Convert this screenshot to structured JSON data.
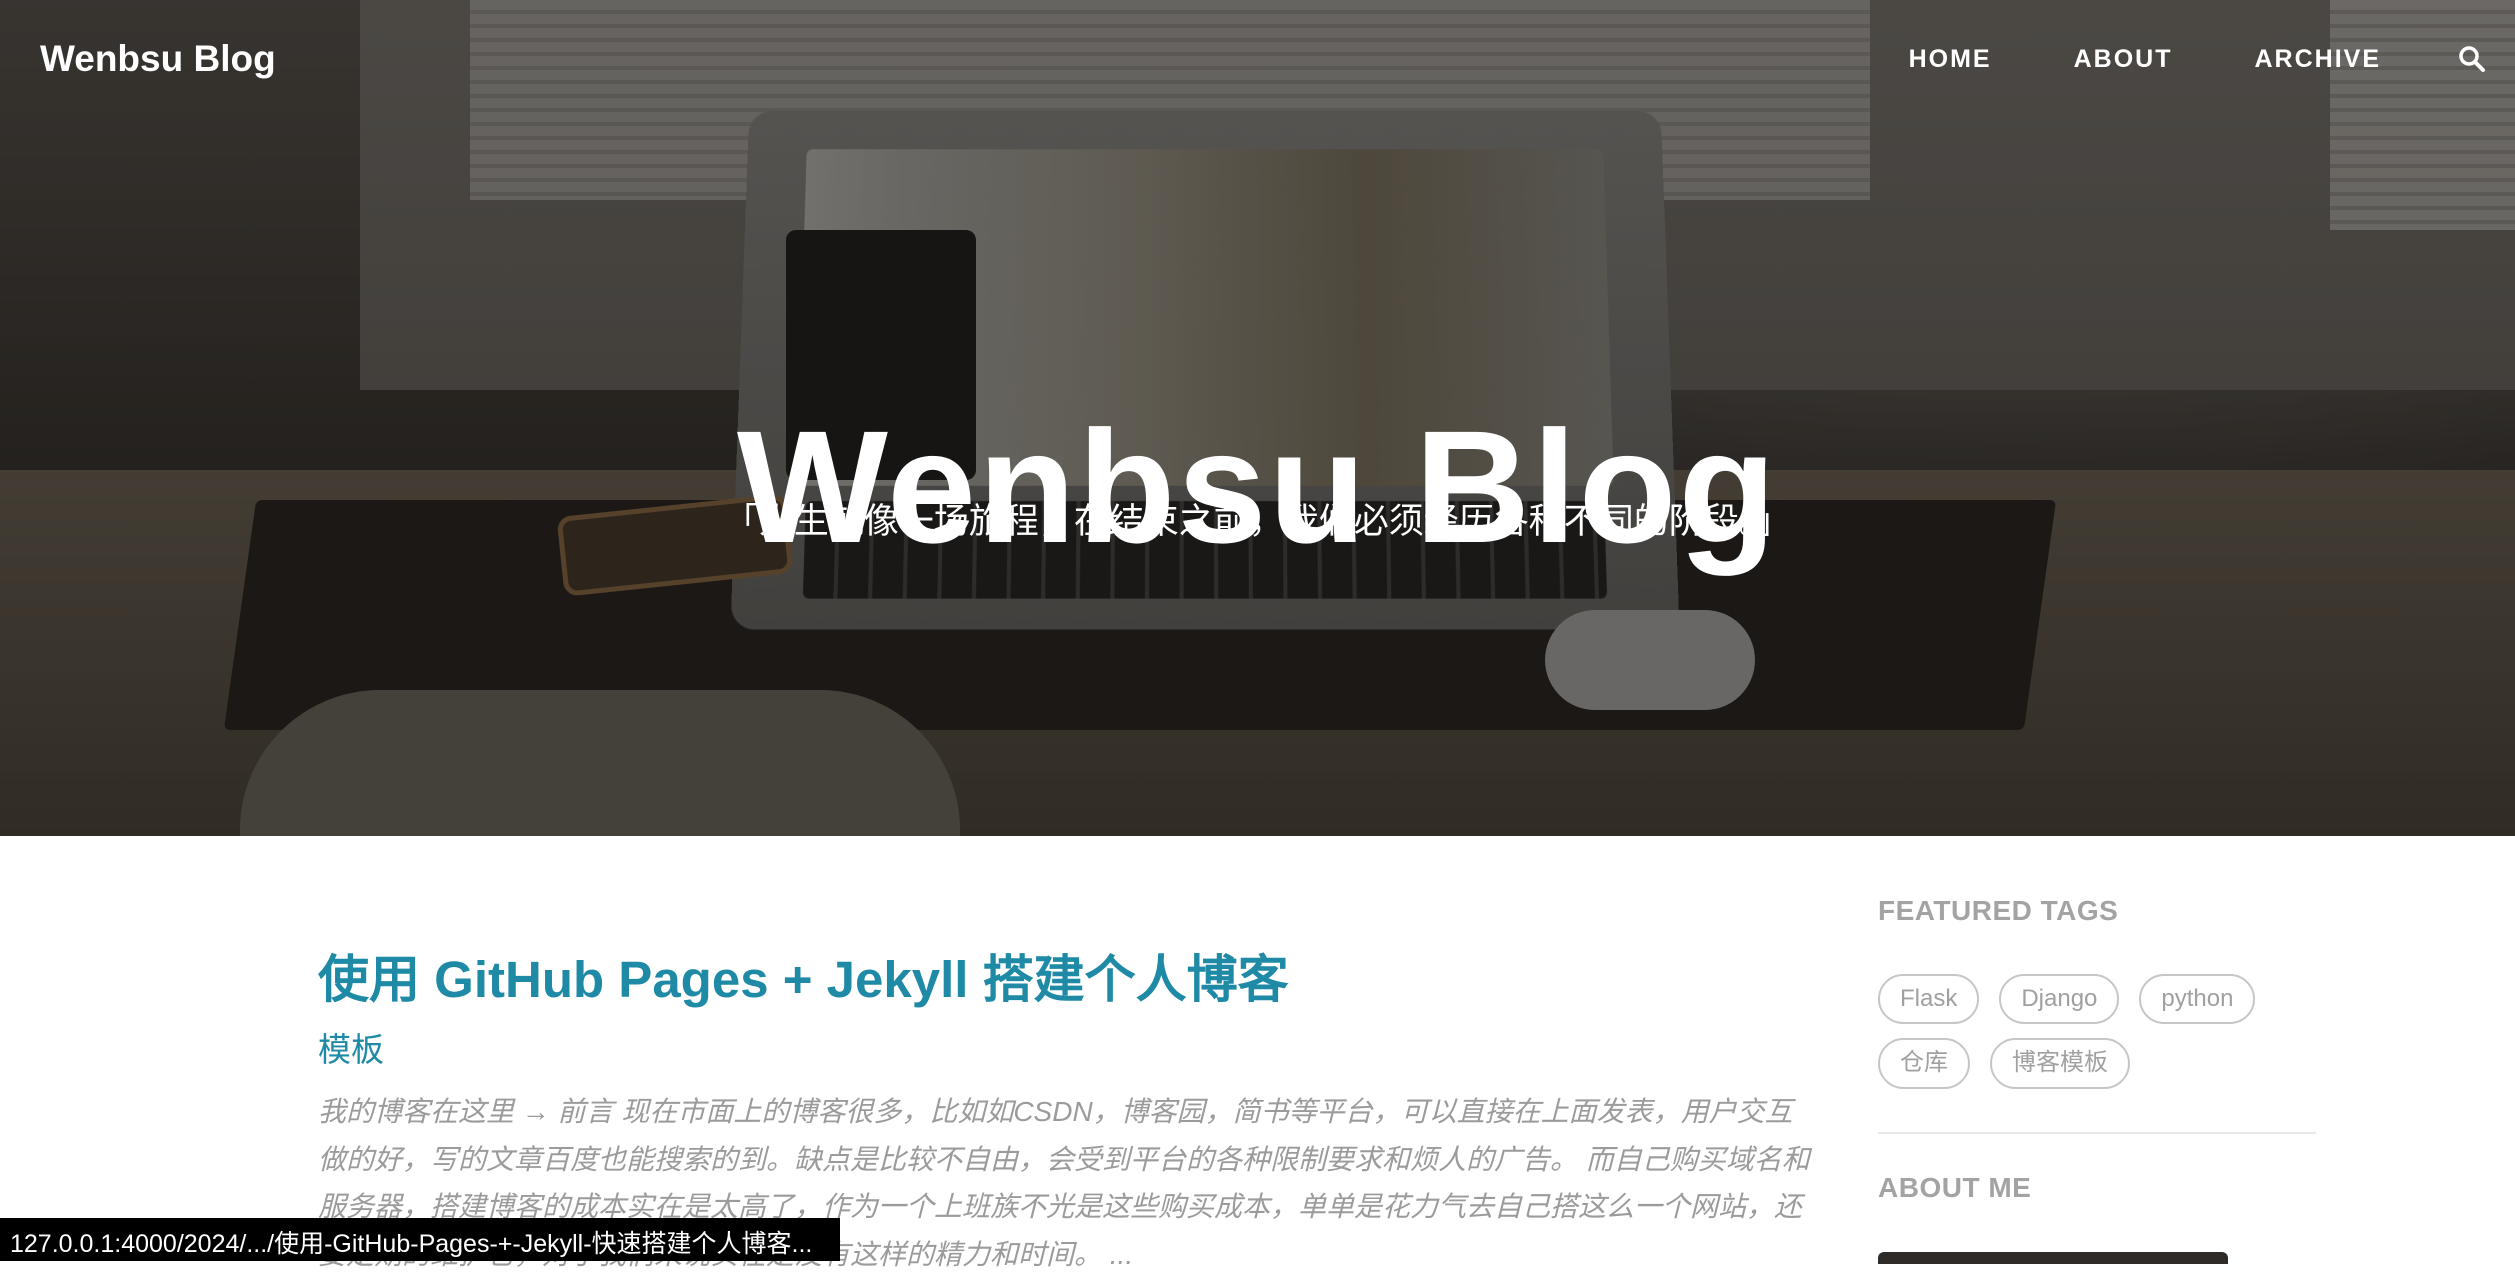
{
  "nav": {
    "brand": "Wenbsu Blog",
    "links": [
      "HOME",
      "ABOUT",
      "ARCHIVE"
    ],
    "search_icon": "search-icon"
  },
  "hero": {
    "title": "Wenbsu Blog",
    "subtitle": "「人生就像一场旅程，在结束之前，我们必须经历各种不同的阶段。」"
  },
  "post": {
    "title": "使用 GitHub Pages + Jekyll 搭建个人博客",
    "subtitle": "模板",
    "excerpt": "我的博客在这里 → 前言 现在市面上的博客很多，比如如CSDN，博客园，简书等平台，可以直接在上面发表，用户交互做的好，写的文章百度也能搜索的到。缺点是比较不自由，会受到平台的各种限制要求和烦人的广告。 而自己购买域名和服务器，搭建博客的成本实在是太高了，作为一个上班族不光是这些购买成本，单单是花力气去自己搭这么一个网站，还要定期的维护它，对于我们来说实在是没有这样的精力和时间。 ..."
  },
  "sidebar": {
    "featured_tags_heading": "FEATURED TAGS",
    "tags": [
      "Flask",
      "Django",
      "python",
      "仓库",
      "博客模板"
    ],
    "about_heading": "ABOUT ME"
  },
  "status_bar": {
    "url": "127.0.0.1:4000/2024/.../使用-GitHub-Pages-+-Jekyll-快速搭建个人博客..."
  },
  "colors": {
    "accent": "#1f8aa6",
    "muted": "#9b9b9b"
  }
}
